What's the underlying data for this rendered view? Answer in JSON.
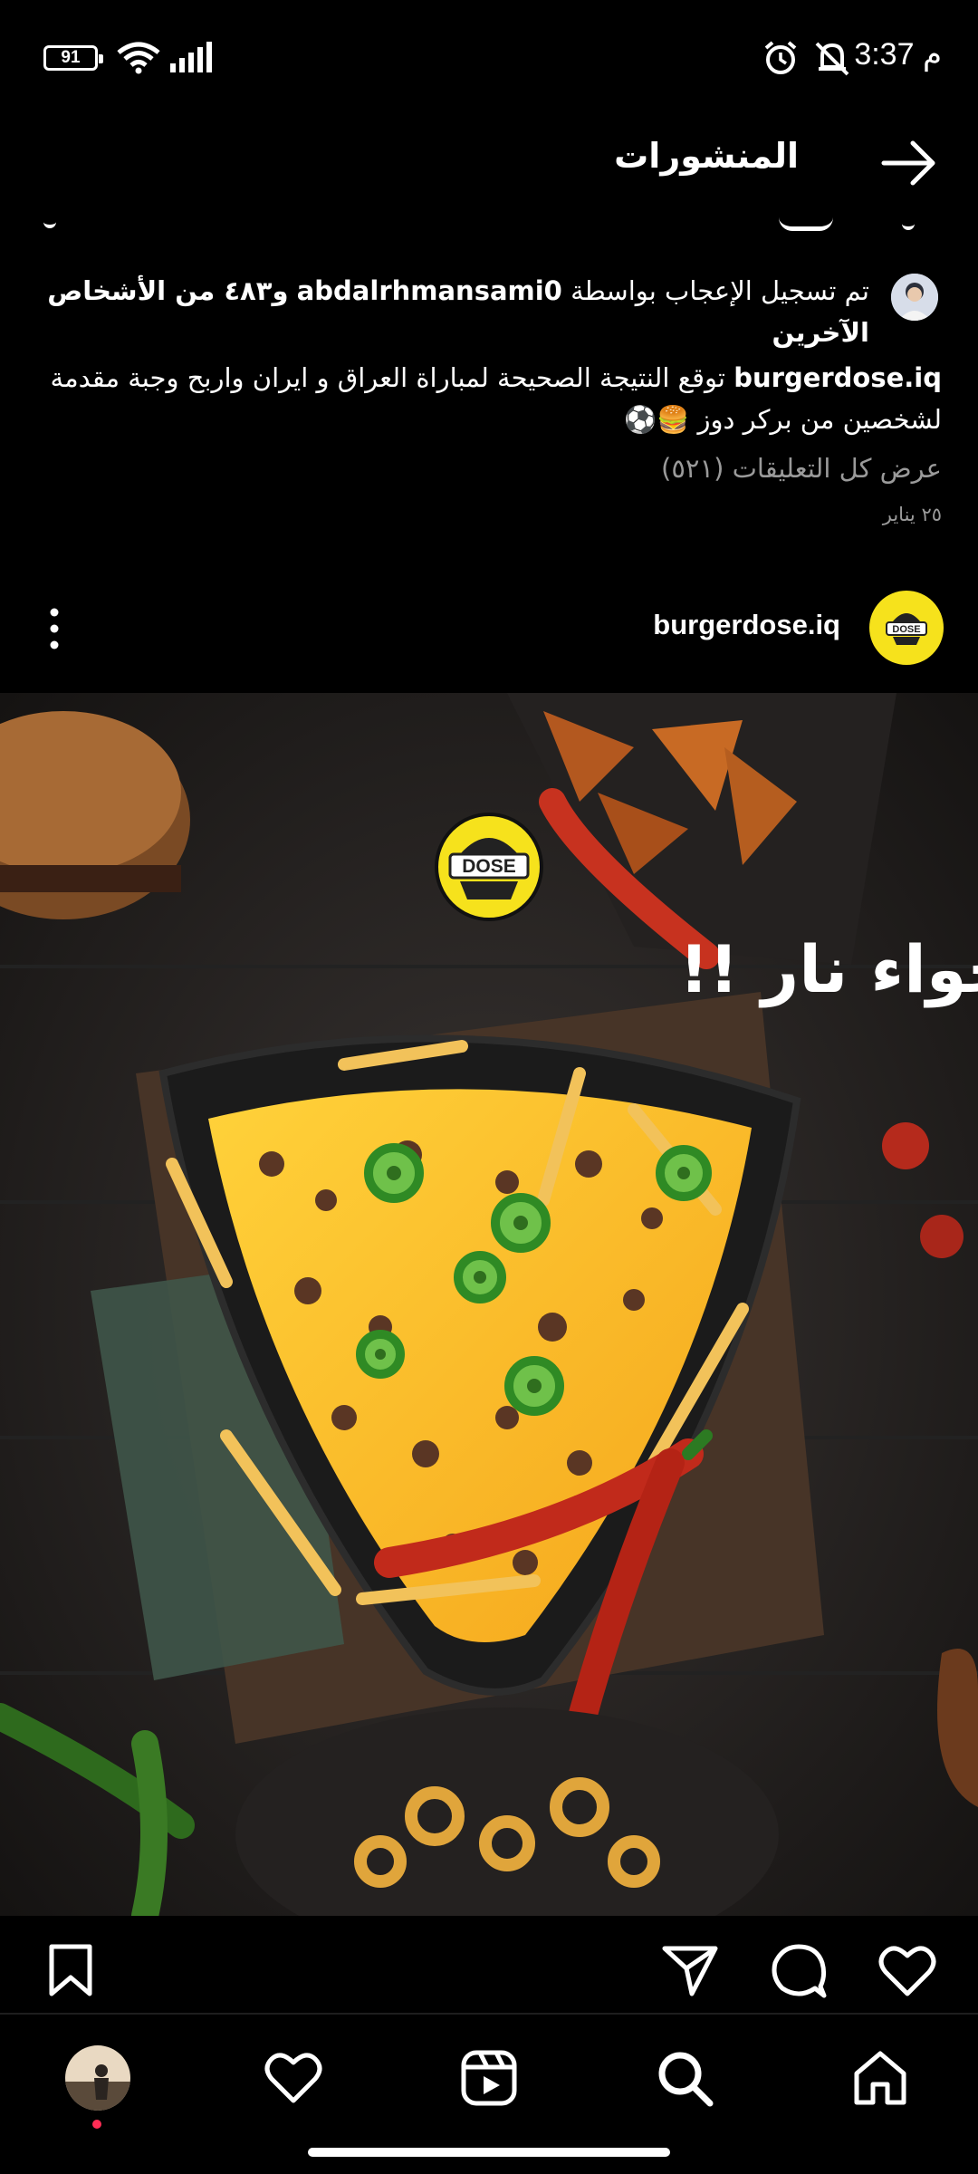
{
  "status_bar": {
    "battery": "91",
    "time": "3:37 م",
    "icons": [
      "battery-icon",
      "wifi-icon",
      "signal-icon",
      "alarm-icon",
      "mute-icon"
    ]
  },
  "header": {
    "title": "المنشورات",
    "back_icon": "arrow-right-icon"
  },
  "previous_post": {
    "liked_by_prefix": "تم تسجيل الإعجاب بواسطة",
    "liked_by_user": "abdalrhmansami0",
    "liked_by_suffix": "و٤٨٣ من الأشخاص الآخرين",
    "caption_user": "burgerdose.iq",
    "caption_text": "توقع النتيجة الصحيحة لمباراة العراق و ايران واربح وجبة مقدمة لشخصين من بركر دوز 🍔⚽",
    "view_comments": "عرض كل التعليقات (٥٢١)",
    "date": "٢٥ يناير"
  },
  "post": {
    "username": "burgerdose.iq",
    "avatar_logo": "DOSE",
    "image_logo": "DOSE",
    "image_headline": "خلي الاجواء نار !!",
    "more_icon": "more-vertical-icon"
  },
  "actions": {
    "icons": [
      "heart-icon",
      "comment-icon",
      "share-icon",
      "bookmark-icon"
    ]
  },
  "bottom_nav": {
    "items": [
      "home-icon",
      "search-icon",
      "reels-icon",
      "activity-heart-icon",
      "profile-avatar"
    ]
  },
  "colors": {
    "background": "#000000",
    "muted_text": "#9a9a9a",
    "brand_yellow": "#f6e21c",
    "notification_dot": "#ff2d55"
  }
}
